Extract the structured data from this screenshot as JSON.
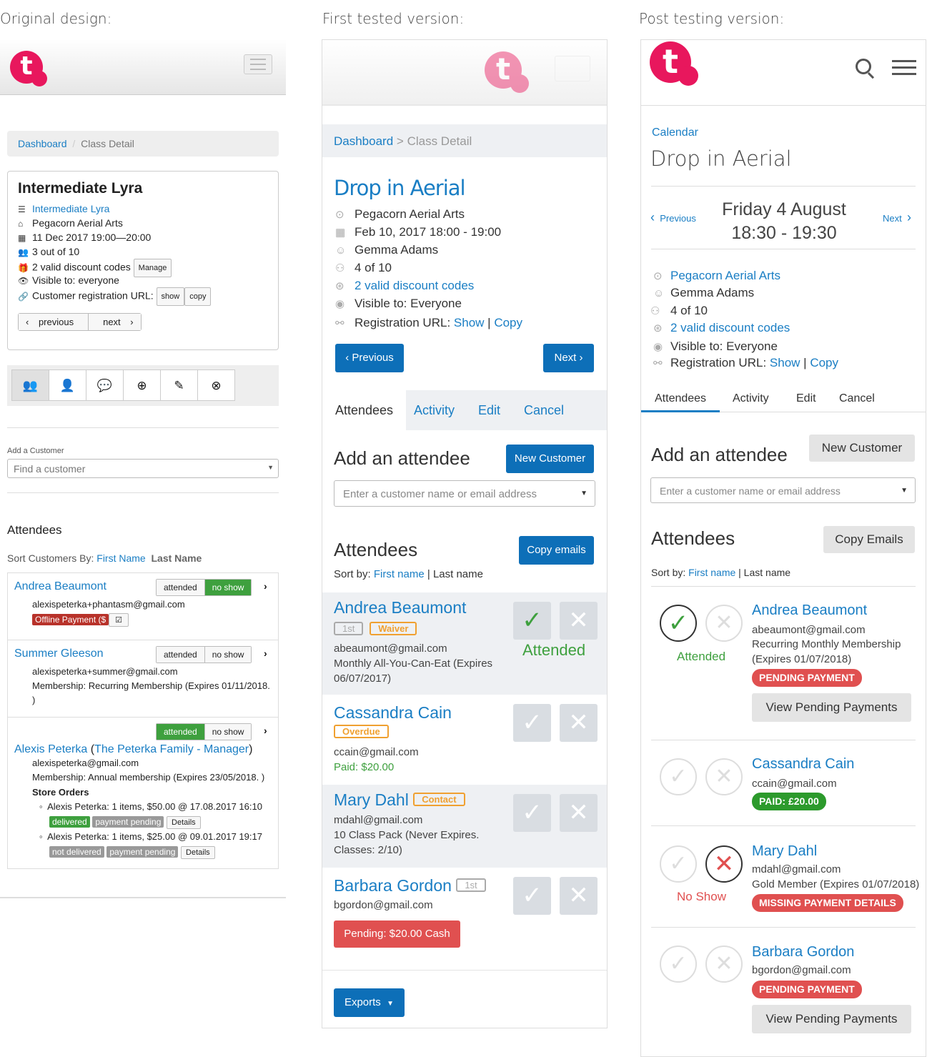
{
  "captions": {
    "original": "Original design:",
    "first": "First tested version:",
    "post": "Post testing version:"
  },
  "logo": "t",
  "colors": {
    "brand_pink": "#e8175d",
    "link_blue": "#1a7ec4",
    "button_blue": "#0d6fb8",
    "green": "#3ea03e",
    "red": "#e05050",
    "orange": "#f0a030"
  },
  "p1": {
    "breadcrumb": {
      "home": "Dashboard",
      "sep": "/",
      "current": "Class Detail"
    },
    "title": "Intermediate Lyra",
    "class_link": "Intermediate Lyra",
    "venue": "Pegacorn Aerial Arts",
    "datetime": "11 Dec 2017 19:00—20:00",
    "capacity": "3 out of 10",
    "discounts": "2 valid discount codes",
    "manage": "Manage",
    "visible": "Visible to: everyone",
    "regurl": "Customer registration URL:",
    "show": "show",
    "copy": "copy",
    "prev": "previous",
    "next": "next",
    "add_label": "Add a Customer",
    "find_placeholder": "Find a customer",
    "attendees_title": "Attendees",
    "sort_label": "Sort Customers By:",
    "sort_first": "First Name",
    "sort_last": "Last Name",
    "attended": "attended",
    "noshow": "no show",
    "a1": {
      "name": "Andrea Beaumont",
      "email": "alexispeterka+phantasm@gmail.com",
      "offline": "Offline Payment ($"
    },
    "a2": {
      "name": "Summer Gleeson",
      "email": "alexispeterka+summer@gmail.com",
      "membership": "Membership: Recurring Membership (Expires 01/11/2018.",
      "close": ")"
    },
    "a3": {
      "name": "Alexis Peterka",
      "paren_open": " (",
      "family": "The Peterka Family - Manager",
      "paren_close": ")",
      "email": "alexispeterka@gmail.com",
      "membership": "Membership: Annual membership (Expires 23/05/2018. )",
      "orders": "Store Orders",
      "o1": "Alexis Peterka: 1 items, $50.00 @ 17.08.2017 16:10",
      "o1_s1": "delivered",
      "o1_s2": "payment pending",
      "o2": "Alexis Peterka: 1 items, $25.00 @ 09.01.2017 19:17",
      "o2_s1": "not delivered",
      "o2_s2": "payment pending",
      "details": "Details"
    }
  },
  "p2": {
    "breadcrumb": {
      "home": "Dashboard",
      "sep": ">",
      "current": "Class Detail"
    },
    "title": "Drop in Aerial",
    "venue": "Pegacorn Aerial Arts",
    "datetime": "Feb 10, 2017 18:00 - 19:00",
    "teacher": "Gemma Adams",
    "capacity": "4 of 10",
    "discounts": "2 valid discount codes",
    "visible": "Visible to: Everyone",
    "regurl": "Registration URL:",
    "show": "Show",
    "sep": " | ",
    "copy": "Copy",
    "prev": "Previous",
    "next": "Next",
    "tabs": [
      "Attendees",
      "Activity",
      "Edit",
      "Cancel"
    ],
    "add_title": "Add an attendee",
    "new_customer": "New Customer",
    "search_placeholder": "Enter a customer name or email address",
    "attendees_title": "Attendees",
    "copy_emails": "Copy emails",
    "sort_label": "Sort by:",
    "sort_first": "First name",
    "sort_last": " | Last name",
    "a1": {
      "name": "Andrea Beaumont",
      "b1": "1st",
      "b2": "Waiver",
      "email": "abeaumont@gmail.com",
      "plan": "Monthly All-You-Can-Eat (Expires",
      "plan2": "06/07/2017)",
      "status": "Attended"
    },
    "a2": {
      "name": "Cassandra Cain",
      "b1": "Overdue",
      "email": "ccain@gmail.com",
      "paid": "Paid: $20.00"
    },
    "a3": {
      "name": "Mary Dahl",
      "b1": "Contact",
      "email": "mdahl@gmail.com",
      "plan": "10 Class Pack (Never Expires.",
      "plan2": "Classes: 2/10)"
    },
    "a4": {
      "name": "Barbara Gordon",
      "b1": "1st",
      "email": "bgordon@gmail.com",
      "pending": "Pending: $20.00 Cash"
    },
    "exports": "Exports"
  },
  "p3": {
    "calendar": "Calendar",
    "title": "Drop in Aerial",
    "prev": "Previous",
    "next": "Next",
    "day": "Friday 4 August",
    "time": "18:30 - 19:30",
    "venue": "Pegacorn Aerial Arts",
    "teacher": "Gemma Adams",
    "capacity": "4 of 10",
    "discounts": "2 valid discount codes",
    "visible": "Visible to: Everyone",
    "regurl": "Registration URL:",
    "show": "Show",
    "sep": " | ",
    "copy": "Copy",
    "tabs": [
      "Attendees",
      "Activity",
      "Edit",
      "Cancel"
    ],
    "add_title": "Add an attendee",
    "new_customer": "New Customer",
    "search_placeholder": "Enter a customer name or email address",
    "attendees_title": "Attendees",
    "copy_emails": "Copy Emails",
    "sort_label": "Sort by:",
    "sort_first": "First name",
    "sort_last": " | Last name",
    "a1": {
      "name": "Andrea Beaumont",
      "email": "abeaumont@gmail.com",
      "plan": "Recurring Monthly Membership",
      "plan2": "(Expires 01/07/2018)",
      "pill": "PENDING PAYMENT",
      "status": "Attended",
      "view": "View Pending Payments"
    },
    "a2": {
      "name": "Cassandra Cain",
      "email": "ccain@gmail.com",
      "pill": "PAID: £20.00"
    },
    "a3": {
      "name": "Mary Dahl",
      "email": "mdahl@gmail.com",
      "plan": "Gold Member (Expires 01/07/2018)",
      "pill": "MISSING PAYMENT DETAILS",
      "status": "No Show"
    },
    "a4": {
      "name": "Barbara Gordon",
      "email": "bgordon@gmail.com",
      "pill": "PENDING PAYMENT",
      "view": "View Pending Payments"
    }
  }
}
